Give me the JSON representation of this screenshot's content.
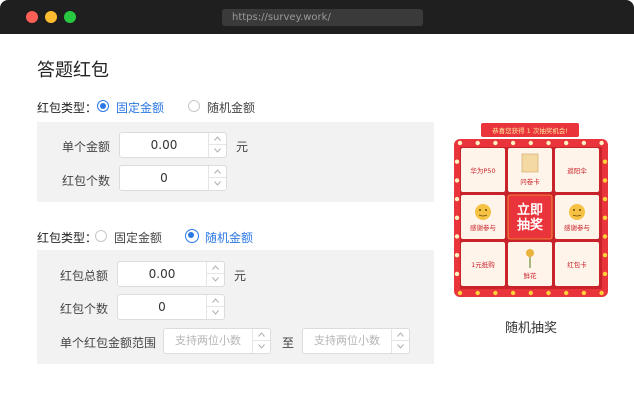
{
  "window": {
    "url": "https://survey.work/"
  },
  "page": {
    "title": "答题红包"
  },
  "section_fixed": {
    "type_label": "红包类型：",
    "option_fixed": "固定金额",
    "option_random": "随机金额",
    "selected": "fixed",
    "amount_label": "单个金额",
    "amount_value": "0.00",
    "amount_unit": "元",
    "count_label": "红包个数",
    "count_value": "0"
  },
  "section_random": {
    "type_label": "红包类型：",
    "option_fixed": "固定金额",
    "option_random": "随机金额",
    "selected": "random",
    "total_label": "红包总额",
    "total_value": "0.00",
    "total_unit": "元",
    "count_label": "红包个数",
    "count_value": "0",
    "range_label": "单个红包金额范围",
    "range_min_placeholder": "支持两位小数",
    "range_separator": "至",
    "range_max_placeholder": "支持两位小数"
  },
  "lottery": {
    "banner": "恭喜您获得 1 次抽奖机会!",
    "center_button": [
      "立即",
      "抽奖"
    ],
    "cells": [
      "华为P50",
      "问卷卡",
      "遮阳伞",
      "感谢参与",
      "感谢参与",
      "1元抵购",
      "鲜花",
      "红包卡"
    ],
    "caption": "随机抽奖"
  },
  "colors": {
    "accent": "#2b78e4",
    "panel": "#f2f2f2",
    "lottery_red": "#e8343a",
    "lottery_cell": "#fff4ea",
    "bulb": "#ffd23a"
  }
}
